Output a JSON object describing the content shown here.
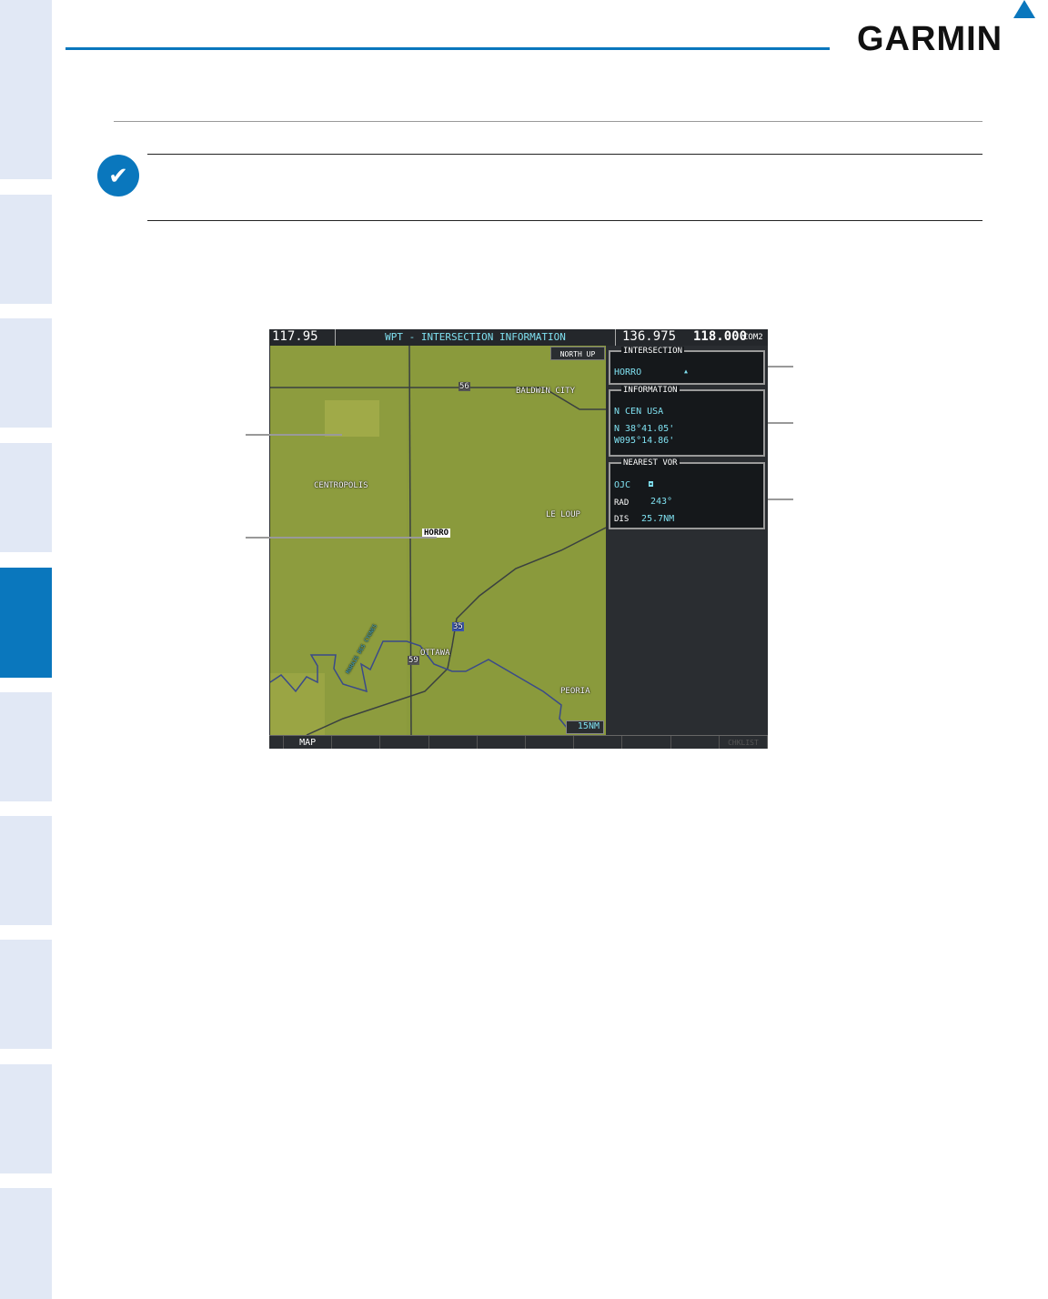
{
  "brand": {
    "logo": "GARMIN",
    "accent": "#0a77bd"
  },
  "sidebar": {
    "tabs": 10,
    "active_index": 4
  },
  "screen": {
    "topbar": {
      "nav_freq": "117.95",
      "title": "WPT - INTERSECTION INFORMATION",
      "com_standby": "136.975",
      "com_active": "118.000",
      "com_label": "COM2"
    },
    "map": {
      "orientation": "NORTH UP",
      "range": "15NM",
      "labels": {
        "baldwin": "BALDWIN CITY",
        "centropolis": "CENTROPOLIS",
        "le_loup": "LE LOUP",
        "horro": "HORRO",
        "ottawa": "OTTAWA",
        "peoria": "PEORIA",
        "river": "MARAIS DES CYGNES"
      },
      "shields": {
        "us56": "56",
        "i35": "35",
        "us59": "59"
      }
    },
    "intersection": {
      "title": "INTERSECTION",
      "ident": "HORRO"
    },
    "information": {
      "title": "INFORMATION",
      "region": "N CEN USA",
      "lat": "N 38°41.05'",
      "lon": "W095°14.86'"
    },
    "nearest_vor": {
      "title": "NEAREST VOR",
      "ident": "OJC",
      "rad_label": "RAD",
      "rad": "243°",
      "dis_label": "DIS",
      "dis": "25.7NM"
    },
    "softkeys": [
      "",
      "MAP",
      "",
      "",
      "",
      "",
      "",
      "",
      "",
      "",
      "CHKLIST"
    ]
  }
}
